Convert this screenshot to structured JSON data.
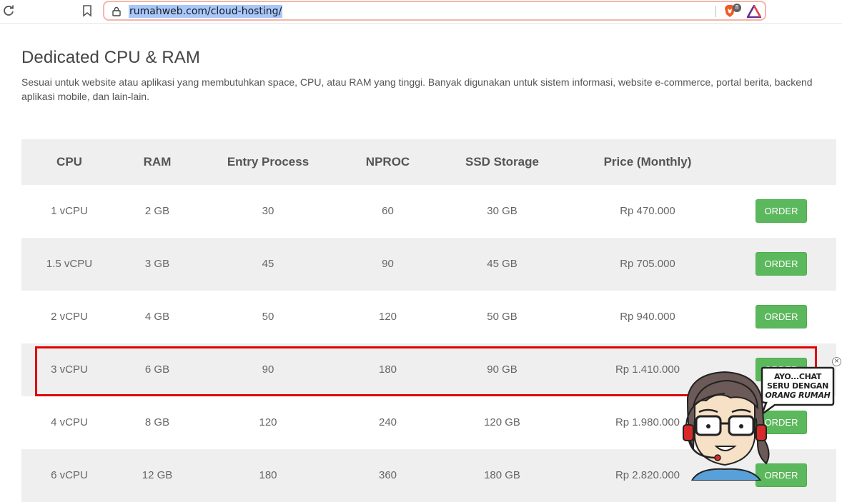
{
  "browser": {
    "url": "rumahweb.com/cloud-hosting/",
    "brave_badge": "8"
  },
  "section": {
    "title": "Dedicated CPU & RAM",
    "description": "Sesuai untuk website atau aplikasi yang membutuhkan space, CPU, atau RAM yang tinggi. Banyak digunakan untuk sistem informasi, website e-commerce, portal berita, backend aplikasi mobile, dan lain-lain."
  },
  "table": {
    "headers": [
      "CPU",
      "RAM",
      "Entry Process",
      "NPROC",
      "SSD Storage",
      "Price (Monthly)"
    ],
    "rows": [
      [
        "1 vCPU",
        "2 GB",
        "30",
        "60",
        "30 GB",
        "Rp 470.000"
      ],
      [
        "1.5 vCPU",
        "3 GB",
        "45",
        "90",
        "45 GB",
        "Rp 705.000"
      ],
      [
        "2 vCPU",
        "4 GB",
        "50",
        "120",
        "50 GB",
        "Rp 940.000"
      ],
      [
        "3 vCPU",
        "6 GB",
        "90",
        "180",
        "90 GB",
        "Rp 1.410.000"
      ],
      [
        "4 vCPU",
        "8 GB",
        "120",
        "240",
        "120 GB",
        "Rp 1.980.000"
      ],
      [
        "6 vCPU",
        "12 GB",
        "180",
        "360",
        "180 GB",
        "Rp 2.820.000"
      ]
    ],
    "order_label": "ORDER"
  },
  "chat": {
    "line1": "AYO...CHAT",
    "line2": "SERU DENGAN",
    "line3": "ORANG RUMAH",
    "close": "×"
  },
  "colors": {
    "order_green": "#5cb85c",
    "highlight_red": "#e00000",
    "row_alt": "#efefef"
  },
  "icons": {
    "reload": "reload-icon",
    "bookmark": "bookmark-icon",
    "lock": "lock-icon",
    "brave": "brave-shield-icon",
    "rewards": "brave-rewards-icon"
  }
}
